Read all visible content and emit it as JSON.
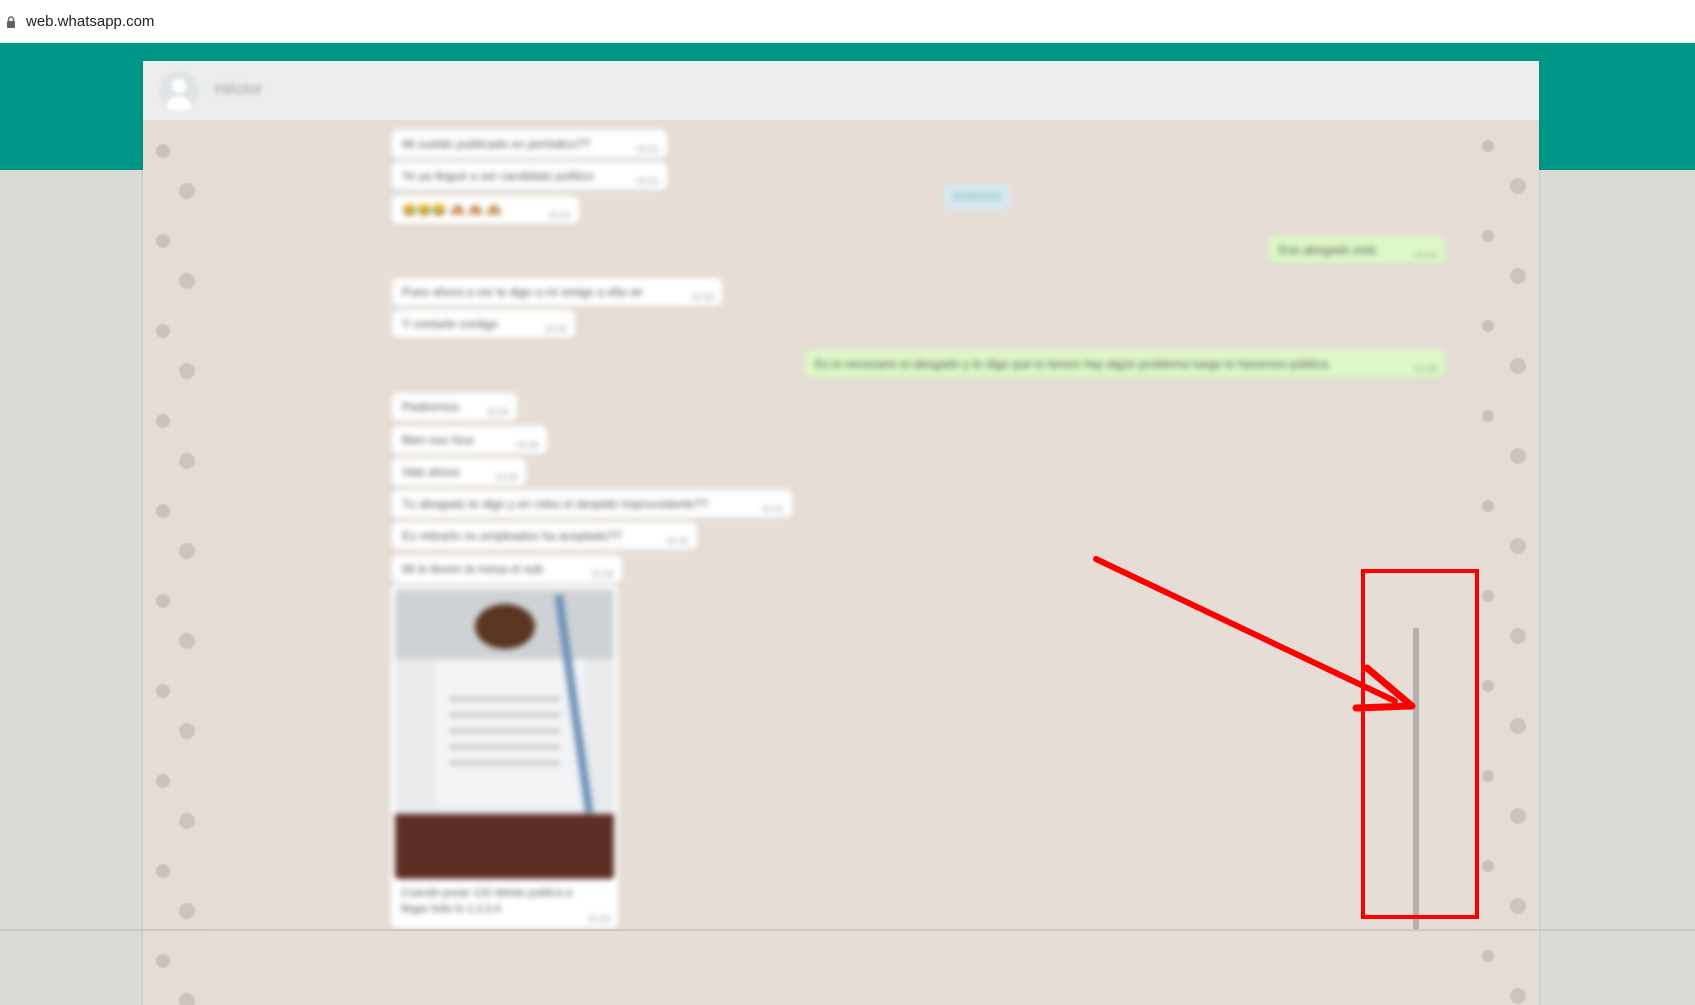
{
  "browser": {
    "url": "web.whatsapp.com"
  },
  "chat": {
    "contact_name": "Héctor",
    "date_chip": "22/9/2020",
    "messages": [
      {
        "dir": "in",
        "text": "Mi sueldo publicado en periódico??",
        "time": "10:21"
      },
      {
        "dir": "in",
        "text": "Yo ya llegué a ser candidato político",
        "time": "10:21"
      },
      {
        "dir": "in",
        "text": "😂😂😂 🙈 🙈 🙈",
        "time": "10:21"
      },
      {
        "dir": "out",
        "text": "Ese abogado está",
        "time": "10:24"
      },
      {
        "dir": "in",
        "text": "Pues ahora a ver le digo a mi amigo a ella sé",
        "time": "10:26"
      },
      {
        "dir": "in",
        "text": "Y contarle contigo",
        "time": "10:26"
      },
      {
        "dir": "out",
        "text": "Es lo necesario el abogado y te diga que lo tienen hay algún problema luego le hacemos pública",
        "time": "10:28"
      },
      {
        "dir": "in",
        "text": "Pediremos",
        "time": "10:30"
      },
      {
        "dir": "in",
        "text": "Bien eso hice",
        "time": "10:30"
      },
      {
        "dir": "in",
        "text": "Vale ahora",
        "time": "10:30"
      },
      {
        "dir": "in",
        "text": "Tu abogado te digo y en roles el despido improcedente??",
        "time": "10:31"
      },
      {
        "dir": "in",
        "text": "Es retirarlo no empleados ha aceptado??",
        "time": "10:31"
      },
      {
        "dir": "in",
        "text": "Mi lo lleven la mesa el sub",
        "time": "10:31"
      },
      {
        "dir": "in",
        "text": "Cuando pusar 120 detrás publica a llegar todo lo 1,2,3,4",
        "time": "10:33",
        "image": true
      }
    ]
  },
  "annotation": {
    "color": "#ff0000"
  }
}
